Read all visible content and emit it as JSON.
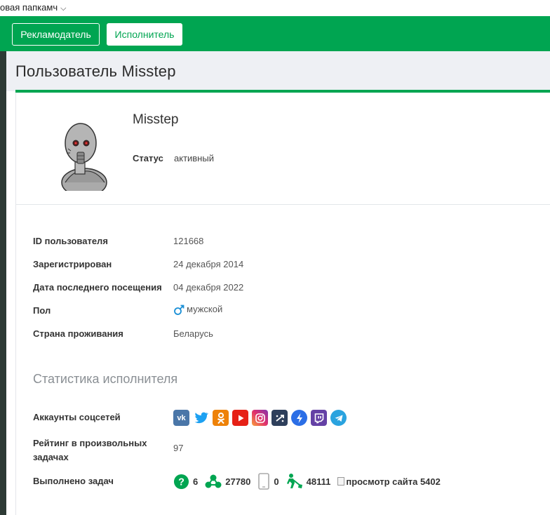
{
  "topbar": {
    "folder_label": "овая папкамч"
  },
  "nav": {
    "advertiser_label": "Рекламодатель",
    "executor_label": "Исполнитель"
  },
  "header": {
    "title": "Пользователь Misstep"
  },
  "profile": {
    "name": "Misstep",
    "status_label": "Статус",
    "status_value": "активный"
  },
  "info": {
    "id_label": "ID пользователя",
    "id_value": "121668",
    "registered_label": "Зарегистрирован",
    "registered_value": "24 декабря 2014",
    "last_visit_label": "Дата последнего посещения",
    "last_visit_value": "04 декабря 2022",
    "gender_label": "Пол",
    "gender_value": "мужской",
    "country_label": "Страна проживания",
    "country_value": "Беларусь"
  },
  "stats": {
    "section_title": "Статистика исполнителя",
    "social_label": "Аккаунты соцсетей",
    "rating_label": "Рейтинг в произвольных задачах",
    "rating_value": "97",
    "tasks_label": "Выполнено задач",
    "tasks": {
      "questions": "6",
      "social": "27780",
      "mobile": "0",
      "work": "48111",
      "site_view_alt": "просмотр сайта",
      "site_view_count": "5402"
    }
  },
  "social_icons": [
    "vk-icon",
    "twitter-icon",
    "odnoklassniki-icon",
    "youtube-icon",
    "instagram-icon",
    "yandex-zen-icon",
    "ask-fm-icon",
    "twitch-icon",
    "telegram-icon"
  ],
  "colors": {
    "brand_green": "#00a551",
    "vk": "#4a76a8",
    "twitter": "#1da1f2",
    "ok": "#ee8208",
    "youtube": "#e62117",
    "instagram": "#c13584",
    "zen": "#2e3f5b",
    "askfm": "#2b6ee6",
    "twitch": "#6441a5",
    "telegram": "#2aa3df"
  }
}
